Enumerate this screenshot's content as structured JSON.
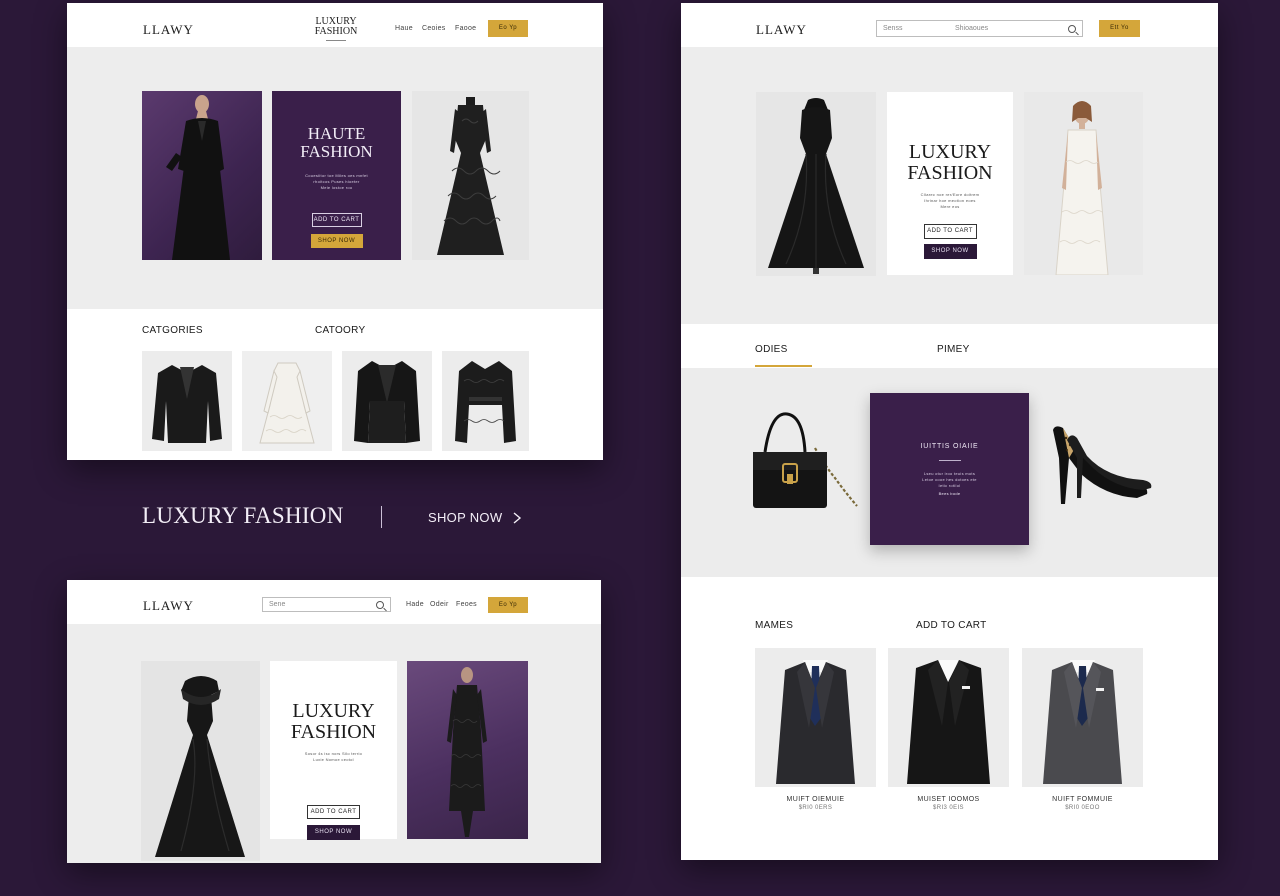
{
  "panel1": {
    "logo": "LLAWY",
    "center_logo": [
      "LUXURY",
      "FASHION"
    ],
    "nav": [
      "Haue",
      "Ceoies",
      "Faooe"
    ],
    "cta": "Eo Yp",
    "hero_card": {
      "title": [
        "HAUTE",
        "FASHION"
      ],
      "body": [
        "Couesiitor toe Miles oes mnfet",
        "rhoitcos Puses hioeter",
        "Meie lostoe roo"
      ],
      "add_to_cart": "ADD TO CART",
      "shop_now": "SHOP NOW"
    },
    "sections": [
      "CATGORIES",
      "CATOORY"
    ]
  },
  "tagline": {
    "title": "LUXURY FASHION",
    "shop_now": "SHOP NOW"
  },
  "panel2": {
    "logo": "LLAWY",
    "search_placeholder": "Senss",
    "search_middle": "Shioaoues",
    "nav": [
      "Hade",
      "Odeir",
      "Feoes"
    ],
    "cta": "Ett Yo",
    "hero_card": {
      "title": [
        "LUXURY",
        "FASHION"
      ],
      "body": [
        "Cllarec noe rer/Eore doitrem",
        "Ihrinar hoe meotion eoes",
        "Mere eos"
      ],
      "add_to_cart": "ADD TO CART",
      "shop_now": "SHOP NOW"
    }
  },
  "panel3": {
    "logo": "LLAWY",
    "search_placeholder": "Sene",
    "search_middle": "Shiaoeoues",
    "cta": "Eo Yp",
    "hero_card": {
      "title": [
        "LUXURY",
        "FASHION"
      ],
      "body": [
        "Sosor 4s isc nors Silo terrio",
        "Luxie Nomoe ceotol"
      ],
      "add_to_cart": "ADD TO CART",
      "shop_now": "SHOP NOW"
    },
    "tabs": [
      "ODIES",
      "PIMEY"
    ],
    "feature": {
      "title": "IUITTIS OIAIIE",
      "body": [
        "Lseu otur iroo teuis mots",
        "Letoe cooe hes dotoes ete",
        "Ietic rotilol"
      ],
      "link": "Bees bode"
    },
    "sections": [
      "MAMES",
      "ADD TO CART"
    ],
    "products": [
      {
        "name": "MUIFT OIEMUIE",
        "price": "$RI0 0ERS"
      },
      {
        "name": "MUISET IOOMOS",
        "price": "$RI3 0EIS"
      },
      {
        "name": "NUIFT FOMMUIE",
        "price": "$RI0 0EOO"
      }
    ]
  },
  "colors": {
    "background": "#2b1838",
    "accent_purple": "#3a1f4a",
    "gold": "#d4a63a",
    "panel": "#ffffff",
    "hero_bg": "#ededed"
  }
}
